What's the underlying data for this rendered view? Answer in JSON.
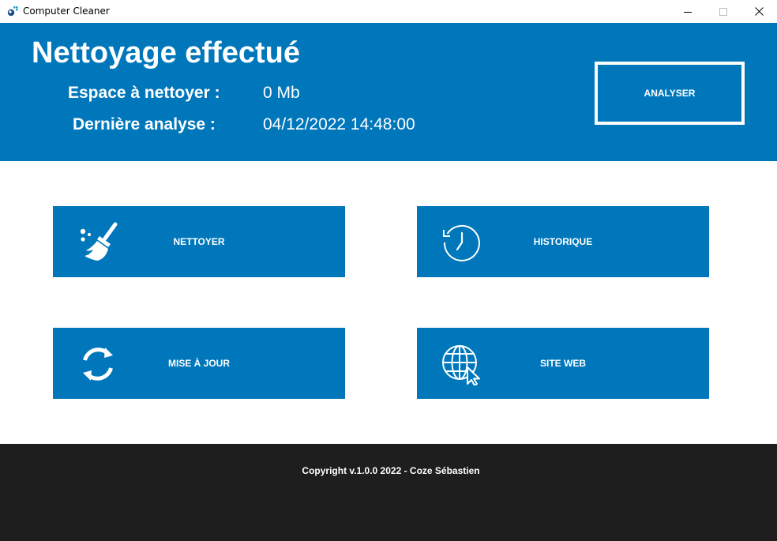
{
  "window": {
    "title": "Computer Cleaner",
    "icons": {
      "app": "app-icon",
      "minimize": "minimize-icon",
      "maximize": "maximize-icon",
      "close": "close-icon"
    }
  },
  "header": {
    "title": "Nettoyage effectué",
    "space_label": "Espace à nettoyer :",
    "space_value": "0 Mb",
    "last_scan_label": "Dernière analyse :",
    "last_scan_value": "04/12/2022 14:48:00",
    "analyse_button": "ANALYSER"
  },
  "tiles": [
    {
      "label": "NETTOYER",
      "icon": "broom-icon"
    },
    {
      "label": "HISTORIQUE",
      "icon": "history-clock-icon"
    },
    {
      "label": "MISE À JOUR",
      "icon": "refresh-icon"
    },
    {
      "label": "SITE WEB",
      "icon": "globe-cursor-icon"
    }
  ],
  "footer": {
    "copyright": "Copyright v.1.0.0 2022 - Coze Sébastien"
  },
  "colors": {
    "accent": "#0077BB",
    "footer": "#1E1E1E",
    "text_on_accent": "#FFFFFF"
  }
}
